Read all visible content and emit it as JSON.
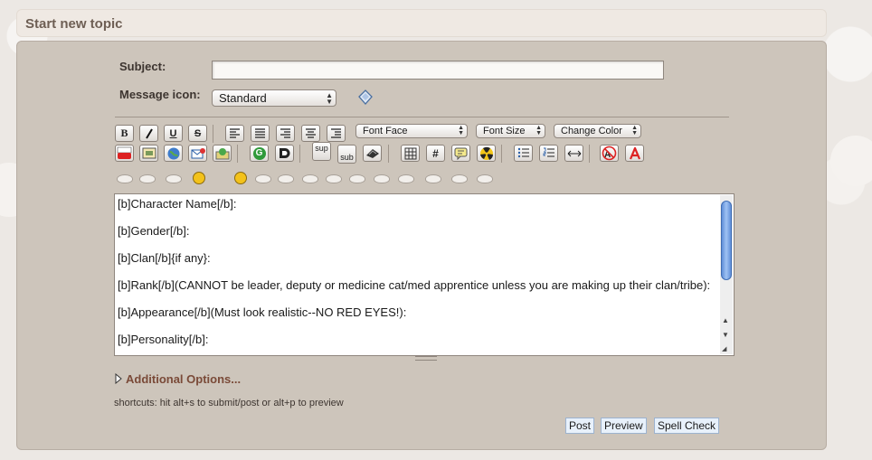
{
  "header": {
    "title": "Start new topic"
  },
  "form": {
    "subject_label": "Subject:",
    "subject_value": "",
    "message_icon_label": "Message icon:",
    "message_icon_value": "Standard"
  },
  "toolbar": {
    "bold": "B",
    "italic": "I",
    "underline": "U",
    "strike": "S",
    "font_face": "Font Face",
    "font_size": "Font Size",
    "change_color": "Change Color",
    "google": "G",
    "sup": "sup",
    "sub": "sub",
    "hash": "#"
  },
  "editor": {
    "content": "[b]Character Name[/b]:\n\n[b]Gender[/b]:\n\n[b]Clan[/b]{if any}:\n\n[b]Rank[/b](CANNOT be leader, deputy or medicine cat/med apprentice unless you are making up their clan/tribe):\n\n[b]Appearance[/b](Must look realistic--NO RED EYES!):\n\n[b]Personality[/b]:"
  },
  "additional_options": "Additional Options...",
  "shortcuts": "shortcuts: hit alt+s to submit/post or alt+p to preview",
  "buttons": {
    "post": "Post",
    "preview": "Preview",
    "spell_check": "Spell Check"
  },
  "colors": {
    "panel": "#cdc5bb",
    "accent_link": "#7a4a38",
    "scroll_thumb": "#5f8fd8"
  }
}
